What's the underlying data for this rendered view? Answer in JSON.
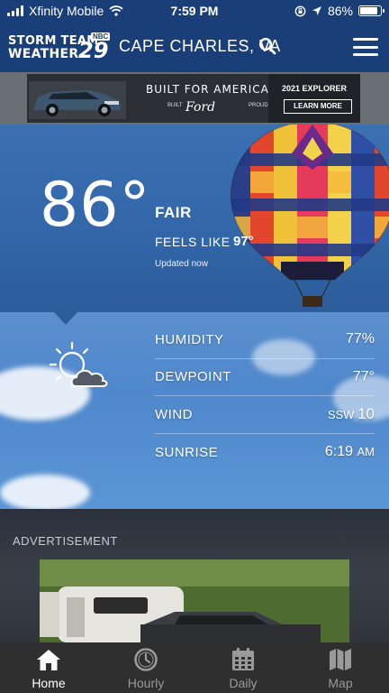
{
  "status_bar": {
    "carrier": "Xfinity Mobile",
    "time": "7:59 PM",
    "battery": "86%",
    "battery_level": 0.86
  },
  "header": {
    "logo_line1": "STORM TEAM",
    "logo_line2": "WEATHER",
    "logo_number": "29",
    "logo_network": "NBC",
    "location": "CAPE CHARLES, VA"
  },
  "top_ad": {
    "headline": "BUILT FOR AMERICA",
    "sub_left": "BUILT",
    "brand": "Ford",
    "sub_right": "PROUD",
    "model": "2021 EXPLORER",
    "cta": "LEARN MORE"
  },
  "current": {
    "temperature": "86°",
    "condition": "FAIR",
    "feels_like_label": "FEELS LIKE",
    "feels_like_value": "97°",
    "updated": "Updated now"
  },
  "details": [
    {
      "label": "HUMIDITY",
      "value": "77%",
      "unit": ""
    },
    {
      "label": "DEWPOINT",
      "value": "77°",
      "unit": ""
    },
    {
      "label": "WIND",
      "value": "SSW ",
      "unit": "10"
    },
    {
      "label": "SUNRISE",
      "value": "6:19 ",
      "unit": "AM"
    }
  ],
  "ad_section": {
    "label": "ADVERTISEMENT"
  },
  "tabs": [
    {
      "label": "Home",
      "icon": "home-icon",
      "active": true
    },
    {
      "label": "Hourly",
      "icon": "clock-icon",
      "active": false
    },
    {
      "label": "Daily",
      "icon": "calendar-icon",
      "active": false
    },
    {
      "label": "Map",
      "icon": "map-icon",
      "active": false
    }
  ],
  "colors": {
    "header": "#1a3f78",
    "current_bg": "#3166a8",
    "details_bg": "#4f88cc",
    "tabbar": "#2f2f2f"
  }
}
